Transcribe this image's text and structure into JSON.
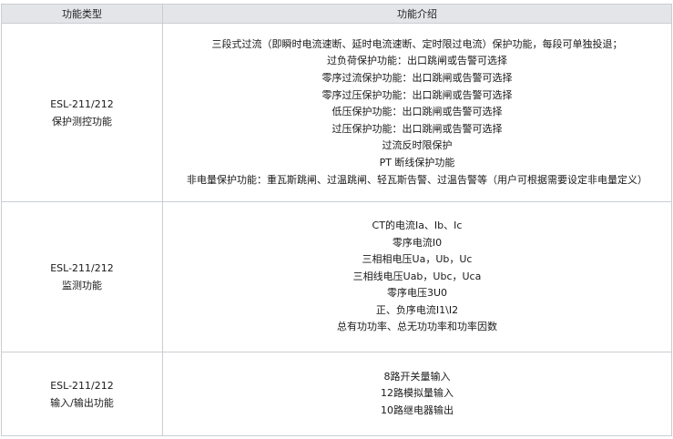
{
  "table": {
    "headers": [
      "功能类型",
      "功能介绍"
    ],
    "rows": [
      {
        "category": [
          "ESL-211/212",
          "保护测控功能"
        ],
        "lines": [
          "三段式过流（即瞬时电流速断、延时电流速断、定时限过电流）保护功能，每段可单独投退；",
          "过负荷保护功能：出口跳闸或告警可选择",
          "零序过流保护功能：出口跳闸或告警可选择",
          "零序过压保护功能：出口跳闸或告警可选择",
          "低压保护功能：出口跳闸或告警可选择",
          "过压保护功能：出口跳闸或告警可选择",
          "过流反时限保护",
          "PT 断线保护功能",
          "非电量保护功能：重瓦斯跳闸、过温跳闸、轻瓦斯告警、过温告警等（用户可根据需要设定非电量定义）"
        ]
      },
      {
        "category": [
          "ESL-211/212",
          "监测功能"
        ],
        "lines": [
          "CT的电流Ia、Ib、Ic",
          "零序电流I0",
          "三相相电压Ua，Ub，Uc",
          "三相线电压Uab，Ubc，Uca",
          "零序电压3U0",
          "正、负序电流I1\\I2",
          "总有功功率、总无功功率和功率因数"
        ]
      },
      {
        "category": [
          "ESL-211/212",
          "输入/输出功能"
        ],
        "lines": [
          "8路开关量输入",
          "12路模拟量输入",
          "10路继电器输出"
        ]
      }
    ]
  }
}
